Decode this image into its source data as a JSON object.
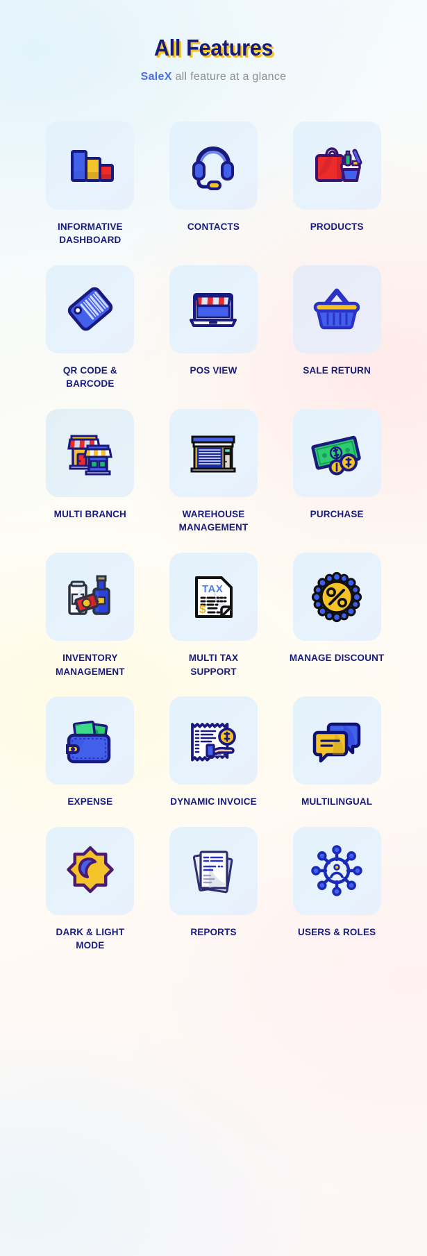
{
  "header": {
    "title": "All Features",
    "subtitle_brand": "SaleX",
    "subtitle_rest": "all feature at a glance",
    "title_color": "#171b7e",
    "title_shadow_color": "#f4c32a",
    "brand_color": "#4b6ee6",
    "subtitle_color": "#8d8d93"
  },
  "theme": {
    "label_color": "#171b7e",
    "card_bg": "#e3f2fc",
    "accent_blue": "#3b50d4",
    "accent_yellow": "#f4c32a",
    "accent_red": "#ed2b2a",
    "accent_green": "#2ecc71",
    "outline_navy": "#1a1a7e"
  },
  "features": [
    {
      "label": "INFORMATIVE DASHBOARD",
      "icon": "bar-chart-icon",
      "tint": ""
    },
    {
      "label": "CONTACTS",
      "icon": "headset-icon",
      "tint": ""
    },
    {
      "label": "PRODUCTS",
      "icon": "shopping-bag-basket-icon",
      "tint": ""
    },
    {
      "label": "QR CODE & BARCODE",
      "icon": "barcode-tag-icon",
      "tint": ""
    },
    {
      "label": "POS VIEW",
      "icon": "laptop-storefront-icon",
      "tint": ""
    },
    {
      "label": "SALE RETURN",
      "icon": "shopping-basket-icon",
      "tint": "tint-lav"
    },
    {
      "label": "MULTI BRANCH",
      "icon": "two-shops-icon",
      "tint": "tint-cool"
    },
    {
      "label": "WAREHOUSE MANAGEMENT",
      "icon": "warehouse-icon",
      "tint": ""
    },
    {
      "label": "PURCHASE",
      "icon": "banknote-coins-icon",
      "tint": ""
    },
    {
      "label": "INVENTORY MANAGEMENT",
      "icon": "grocery-items-icon",
      "tint": ""
    },
    {
      "label": "MULTI TAX SUPPORT",
      "icon": "tax-document-icon",
      "tint": ""
    },
    {
      "label": "MANAGE DISCOUNT",
      "icon": "percent-badge-icon",
      "tint": ""
    },
    {
      "label": "EXPENSE",
      "icon": "wallet-icon",
      "tint": ""
    },
    {
      "label": "DYNAMIC INVOICE",
      "icon": "invoice-hand-coin-icon",
      "tint": ""
    },
    {
      "label": "MULTILINGUAL",
      "icon": "speech-bubbles-icon",
      "tint": ""
    },
    {
      "label": "DARK & LIGHT MODE",
      "icon": "sun-moon-icon",
      "tint": ""
    },
    {
      "label": "REPORTS",
      "icon": "documents-stack-icon",
      "tint": ""
    },
    {
      "label": "USERS & ROLES",
      "icon": "users-roles-icon",
      "tint": ""
    }
  ]
}
